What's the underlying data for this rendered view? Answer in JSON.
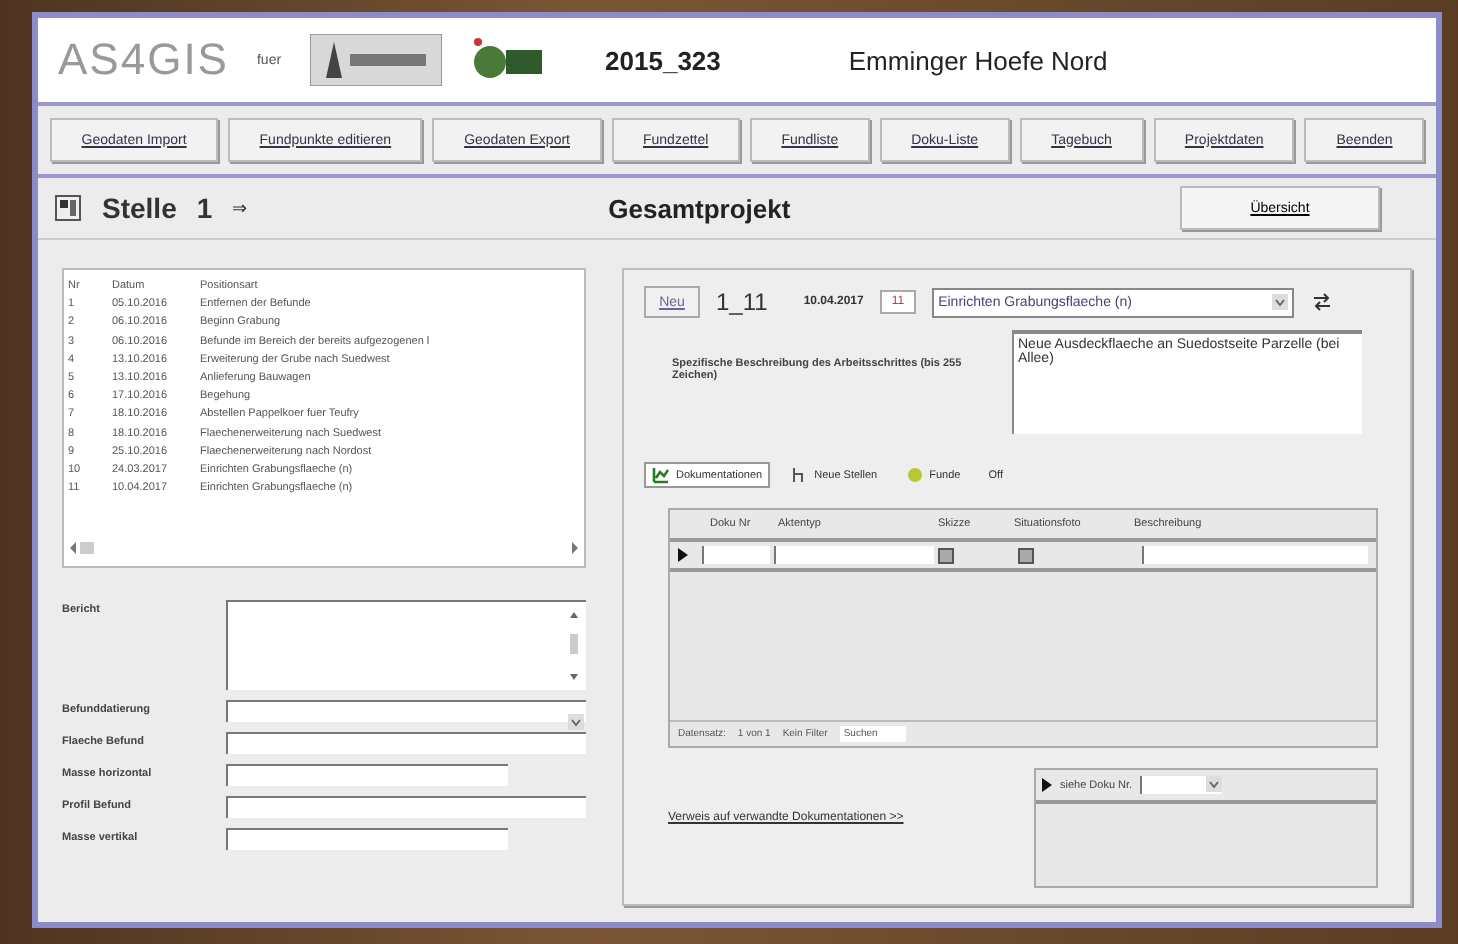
{
  "header": {
    "app_name": "AS4GIS",
    "for_label": "fuer",
    "project_number": "2015_323",
    "project_name": "Emminger Hoefe Nord"
  },
  "toolbar": [
    "Geodaten Import",
    "Fundpunkte editieren",
    "Geodaten Export",
    "Fundzettel",
    "Fundliste",
    "Doku-Liste",
    "Tagebuch",
    "Projektdaten",
    "Beenden"
  ],
  "section": {
    "label": "Stelle",
    "number": "1",
    "arrow": "⇒",
    "title": "Gesamtprojekt",
    "button": "Übersicht"
  },
  "list": {
    "columns": [
      "Nr",
      "Datum",
      "Positionsart"
    ],
    "rows": [
      [
        "1",
        "05.10.2016",
        "Entfernen der Befunde"
      ],
      [
        "2",
        "06.10.2016",
        "Beginn Grabung"
      ],
      [
        "3",
        "06.10.2016",
        "Befunde im Bereich der bereits aufgezogenen l"
      ],
      [
        "4",
        "13.10.2016",
        "Erweiterung der Grube nach Suedwest"
      ],
      [
        "5",
        "13.10.2016",
        "Anlieferung Bauwagen"
      ],
      [
        "6",
        "17.10.2016",
        "Begehung"
      ],
      [
        "7",
        "18.10.2016",
        "Abstellen Pappelkoer fuer Teufry"
      ],
      [
        "8",
        "18.10.2016",
        "Flaechenerweiterung nach Suedwest"
      ],
      [
        "9",
        "25.10.2016",
        "Flaechenerweiterung nach Nordost"
      ],
      [
        "10",
        "24.03.2017",
        "Einrichten Grabungsflaeche (n)"
      ],
      [
        "11",
        "10.04.2017",
        "Einrichten Grabungsflaeche (n)"
      ]
    ]
  },
  "form": [
    {
      "label": "Bericht",
      "kind": "textarea"
    },
    {
      "label": "Befunddatierung",
      "kind": "combo"
    },
    {
      "label": "Flaeche Befund",
      "kind": "wide"
    },
    {
      "label": "Masse horizontal",
      "kind": "short"
    },
    {
      "label": "Profil Befund",
      "kind": "wide"
    },
    {
      "label": "Masse vertikal",
      "kind": "short"
    }
  ],
  "record": {
    "new_button": "Neu",
    "id": "1_11",
    "date": "10.04.2017",
    "number": "11",
    "type": "Einrichten Grabungsflaeche (n)",
    "description_label": "Spezifische Beschreibung des Arbeitsschrittes (bis 255 Zeichen)",
    "description": "Neue Ausdeckflaeche an Suedostseite Parzelle (bei Allee)"
  },
  "tabs": [
    {
      "label": "Dokumentationen",
      "selected": true
    },
    {
      "label": "Neue Stellen",
      "selected": false
    },
    {
      "label": "Funde",
      "selected": false
    },
    {
      "label": "Off",
      "selected": false
    }
  ],
  "grid": {
    "row": {
      "sketch_checked": false,
      "photo_checked": false
    },
    "columns": [
      "Doku Nr",
      "Aktentyp",
      "Skizze",
      "Situationsfoto",
      "Beschreibung"
    ],
    "navigator": {
      "label": "Datensatz:",
      "position": "1 von 1",
      "filter": "Kein Filter",
      "search": "Suchen"
    }
  },
  "link": "Verweis auf verwandte Dokumentationen >>",
  "subform": {
    "label": "siehe Doku Nr."
  }
}
